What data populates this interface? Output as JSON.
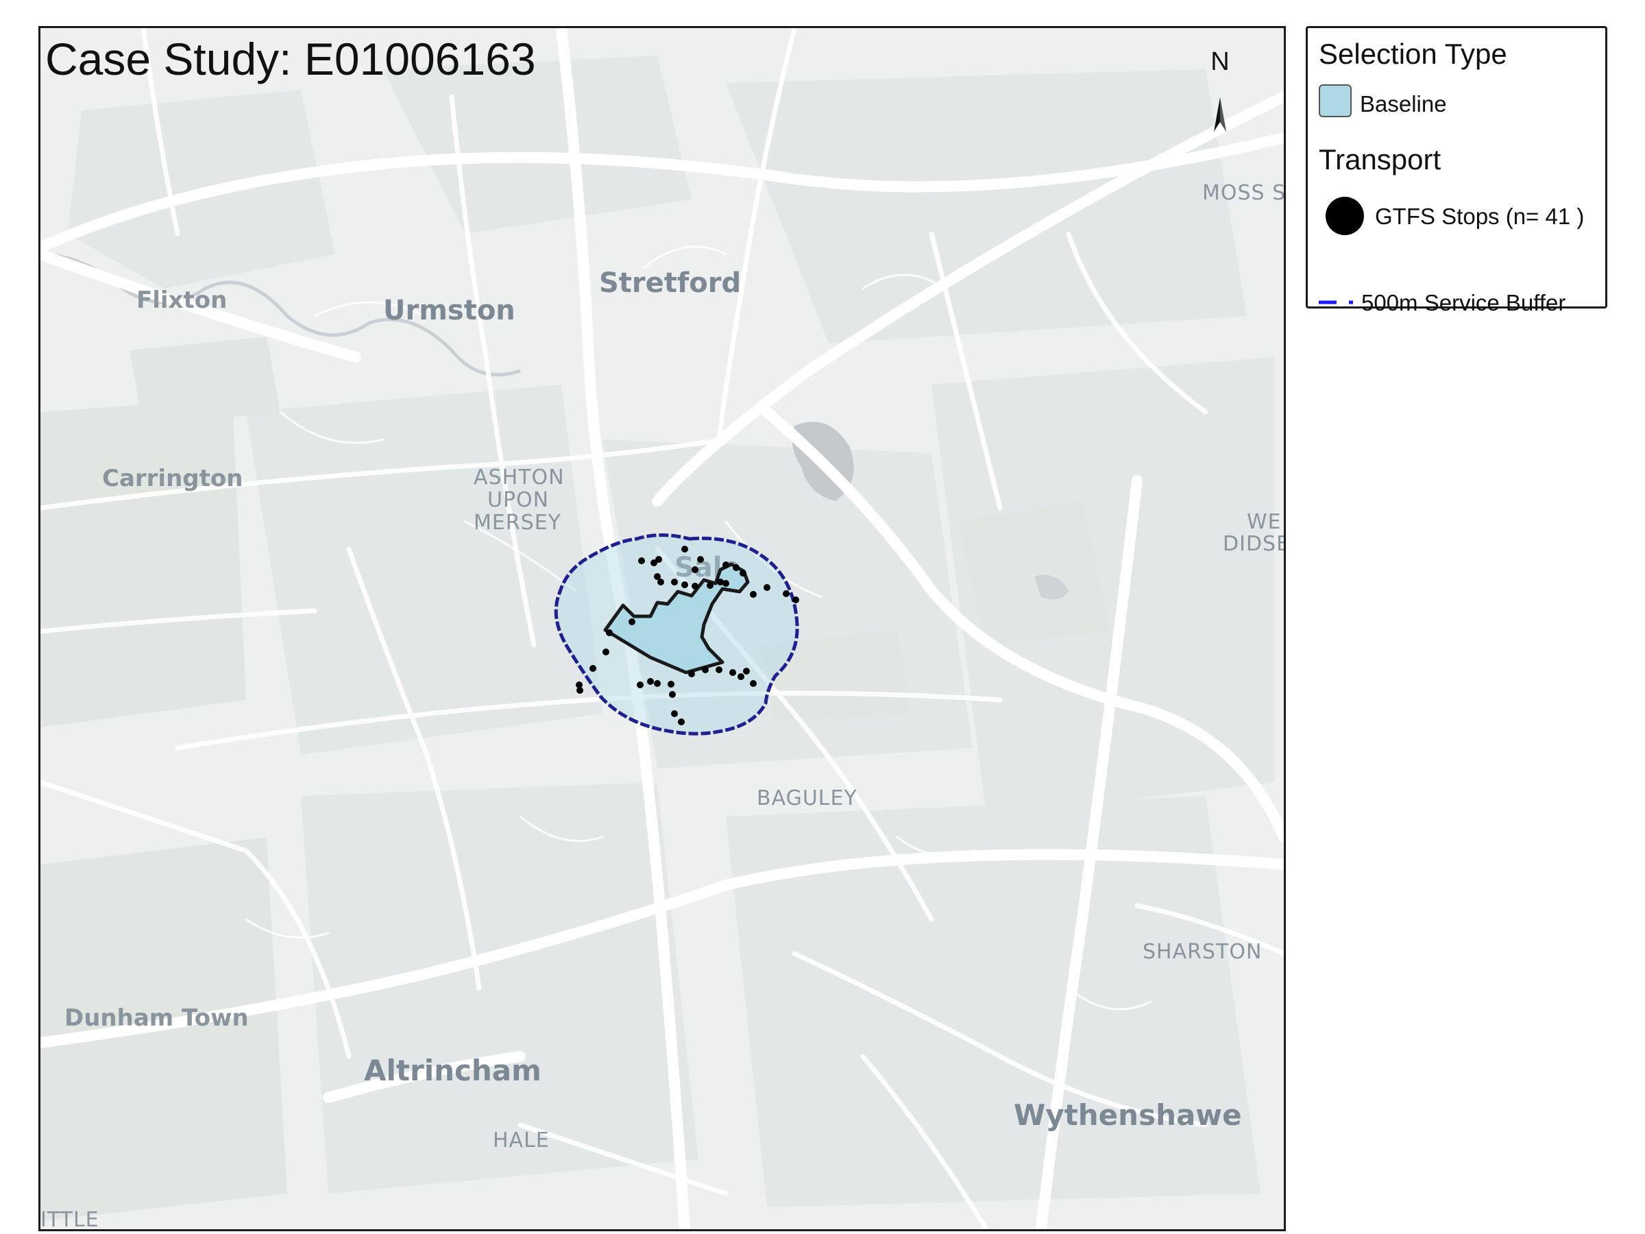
{
  "title": "Case Study: E01006163",
  "north_arrow": {
    "label": "N"
  },
  "legend": {
    "selection_heading": "Selection Type",
    "baseline_label": "Baseline",
    "transport_heading": "Transport",
    "stops_label": "GTFS Stops (n= 41 )",
    "buffer_label": "500m Service Buffer"
  },
  "colors": {
    "baseline_fill": "#add8e6",
    "buffer_outline": "#1f1f8f",
    "stop_fill": "#000000",
    "basemap": "#eef0f0",
    "road": "#ffffff",
    "water": "#c4c9cd"
  },
  "place_labels": {
    "flixton": "Flixton",
    "urmston": "Urmston",
    "stretford": "Stretford",
    "moss": "MOSS S",
    "carrington": "Carrington",
    "ashton_1": "ASHTON",
    "ashton_2": "UPON",
    "ashton_3": "MERSEY",
    "sale": "Sale",
    "west_didsbury_1": "WE",
    "west_didsbury_2": "DIDSB",
    "baguley": "BAGULEY",
    "sharston": "SHARSTON",
    "dunham_town": "Dunham Town",
    "altrincham": "Altrincham",
    "hale": "HALE",
    "wythenshawe": "Wythenshawe",
    "little": "ITTLE"
  }
}
